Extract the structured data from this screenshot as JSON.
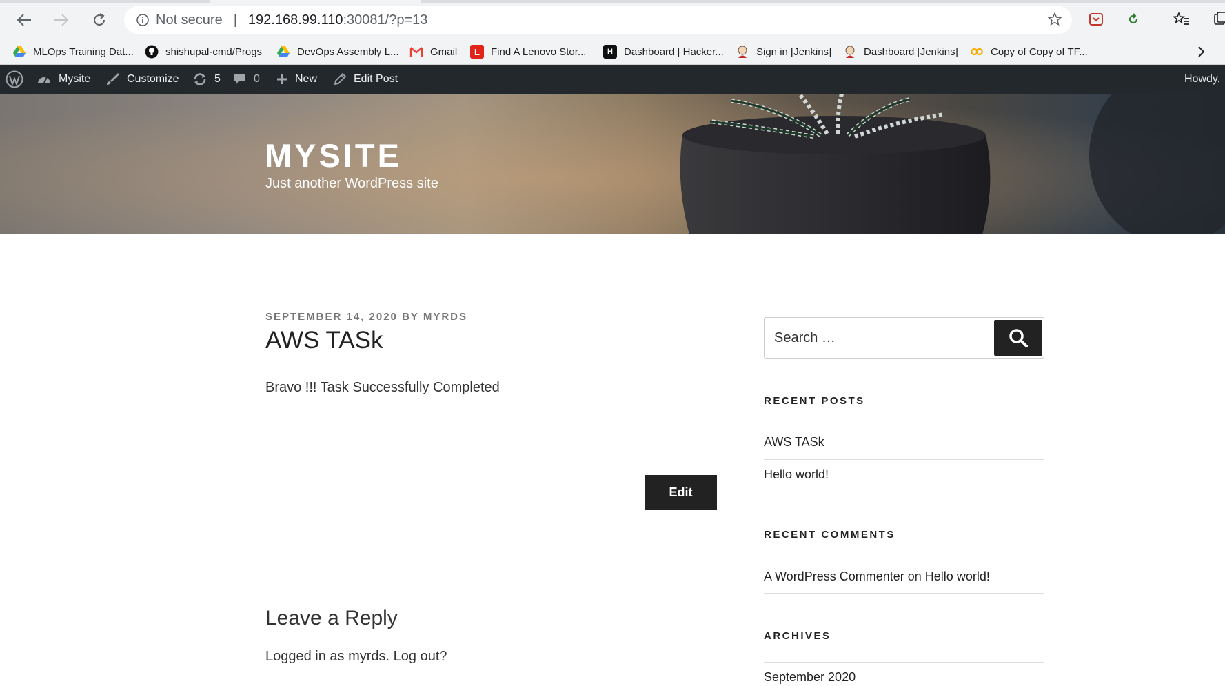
{
  "browser": {
    "address": {
      "security_label": "Not secure",
      "separator": "|",
      "host": "192.168.99.110",
      "path": ":30081/?p=13"
    },
    "bookmarks": [
      {
        "label": "MLOps Training Dat...",
        "icon": "google-drive-icon"
      },
      {
        "label": "shishupal-cmd/Progs",
        "icon": "github-icon"
      },
      {
        "label": "DevOps Assembly L...",
        "icon": "google-drive-icon"
      },
      {
        "label": "Gmail",
        "icon": "gmail-icon"
      },
      {
        "label": "Find A Lenovo Stor...",
        "icon": "lenovo-icon"
      },
      {
        "label": "Dashboard | Hacker...",
        "icon": "hackerrank-icon"
      },
      {
        "label": "Sign in [Jenkins]",
        "icon": "jenkins-icon"
      },
      {
        "label": "Dashboard [Jenkins]",
        "icon": "jenkins-icon"
      },
      {
        "label": "Copy of Copy of TF...",
        "icon": "colab-icon"
      }
    ]
  },
  "adminbar": {
    "site_name": "Mysite",
    "customize": "Customize",
    "updates_count": "5",
    "comments_count": "0",
    "new_label": "New",
    "edit_post": "Edit Post",
    "howdy": "Howdy,"
  },
  "header": {
    "site_title": "MYSITE",
    "tagline": "Just another WordPress site"
  },
  "post": {
    "date": "SEPTEMBER 14, 2020",
    "by": "BY",
    "author": "MYRDS",
    "title": "AWS TASk",
    "body": "Bravo !!! Task Successfully Completed",
    "edit_label": "Edit"
  },
  "comments": {
    "reply_title": "Leave a Reply",
    "logged_in_prefix": "Logged in as",
    "logged_in_user": "myrds.",
    "logout": "Log out?"
  },
  "sidebar": {
    "search_placeholder": "Search …",
    "recent_posts_title": "RECENT POSTS",
    "recent_posts": [
      "AWS TASk",
      "Hello world!"
    ],
    "recent_comments_title": "RECENT COMMENTS",
    "recent_comment": {
      "author": "A WordPress Commenter",
      "on": "on",
      "post": "Hello world!"
    },
    "archives_title": "ARCHIVES",
    "archives": [
      "September 2020"
    ]
  },
  "colors": {
    "adminbar_bg": "#23282d",
    "button_bg": "#222222",
    "meta_gray": "#767676"
  }
}
